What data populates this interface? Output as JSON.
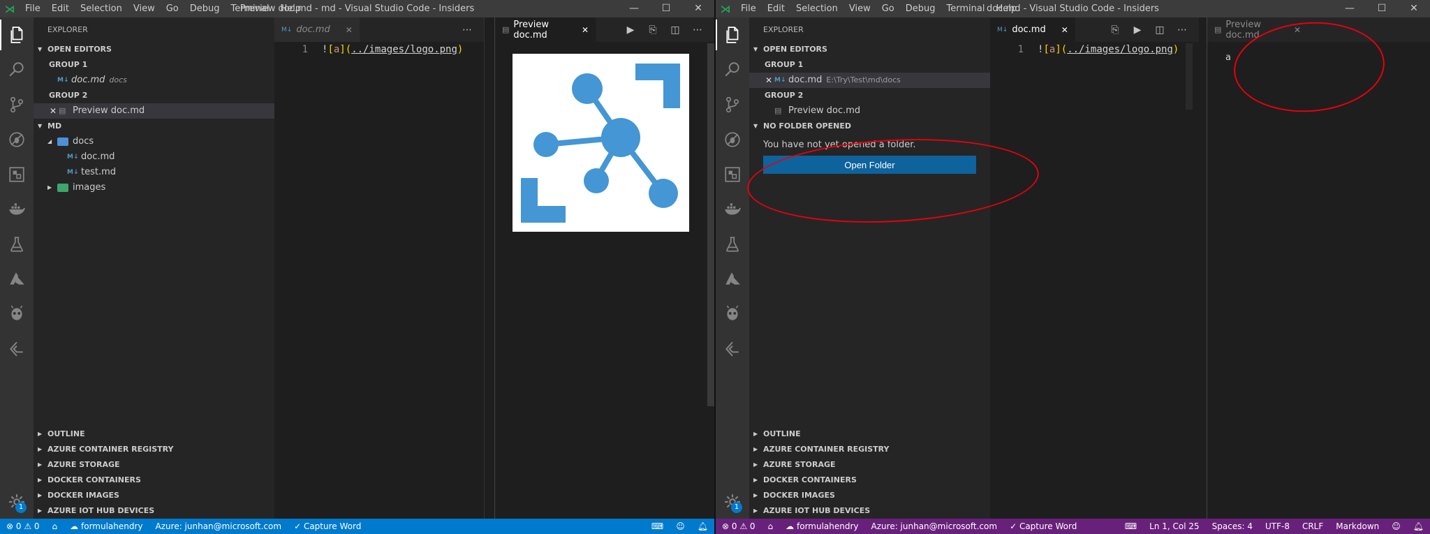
{
  "left": {
    "menu": [
      "File",
      "Edit",
      "Selection",
      "View",
      "Go",
      "Debug",
      "Terminal",
      "Help"
    ],
    "title": "Preview doc.md - md - Visual Studio Code - Insiders",
    "explorer_title": "EXPLORER",
    "open_editors": "OPEN EDITORS",
    "group1": "GROUP 1",
    "group1_file": "doc.md",
    "group1_file_desc": "docs",
    "group2": "GROUP 2",
    "group2_file": "Preview doc.md",
    "folder_section": "MD",
    "tree": {
      "docs": "docs",
      "doc": "doc.md",
      "test": "test.md",
      "images": "images"
    },
    "panels": [
      "OUTLINE",
      "AZURE CONTAINER REGISTRY",
      "AZURE STORAGE",
      "DOCKER CONTAINERS",
      "DOCKER IMAGES",
      "AZURE IOT HUB DEVICES"
    ],
    "tab_editor": "doc.md",
    "tab_preview": "Preview doc.md",
    "line_number": "1",
    "code": {
      "bang": "!",
      "lb": "[",
      "alt": "a",
      "rb": "]",
      "lp": "(",
      "path": "../images/logo.png",
      "rp": ")"
    },
    "status": {
      "errors": "0",
      "warnings": "0",
      "user": "formulahendry",
      "azure": "Azure: junhan@microsoft.com",
      "capture": "Capture Word"
    },
    "badge": "1"
  },
  "right": {
    "menu": [
      "File",
      "Edit",
      "Selection",
      "View",
      "Go",
      "Debug",
      "Terminal",
      "Help"
    ],
    "title": "doc.md - Visual Studio Code - Insiders",
    "explorer_title": "EXPLORER",
    "open_editors": "OPEN EDITORS",
    "group1": "GROUP 1",
    "group1_file": "doc.md",
    "group1_file_desc": "E:\\Try\\Test\\md\\docs",
    "group2": "GROUP 2",
    "group2_file": "Preview doc.md",
    "no_folder": "NO FOLDER OPENED",
    "no_folder_msg": "You have not yet opened a folder.",
    "open_folder_button": "Open Folder",
    "panels": [
      "OUTLINE",
      "AZURE CONTAINER REGISTRY",
      "AZURE STORAGE",
      "DOCKER CONTAINERS",
      "DOCKER IMAGES",
      "AZURE IOT HUB DEVICES"
    ],
    "tab_editor": "doc.md",
    "tab_preview": "Preview doc.md",
    "line_number": "1",
    "code": {
      "bang": "!",
      "lb": "[",
      "alt": "a",
      "rb": "]",
      "lp": "(",
      "path": "../images/logo.png",
      "rp": ")"
    },
    "preview_text": "a",
    "status": {
      "errors": "0",
      "warnings": "0",
      "user": "formulahendry",
      "azure": "Azure: junhan@microsoft.com",
      "capture": "Capture Word",
      "position": "Ln 1, Col 25",
      "spaces": "Spaces: 4",
      "encoding": "UTF-8",
      "eol": "CRLF",
      "language": "Markdown"
    },
    "badge": "1"
  },
  "colors": {
    "status_left": "#007acc",
    "status_right": "#68217a",
    "annotation": "#e8000e",
    "logo": "#4496d4"
  }
}
